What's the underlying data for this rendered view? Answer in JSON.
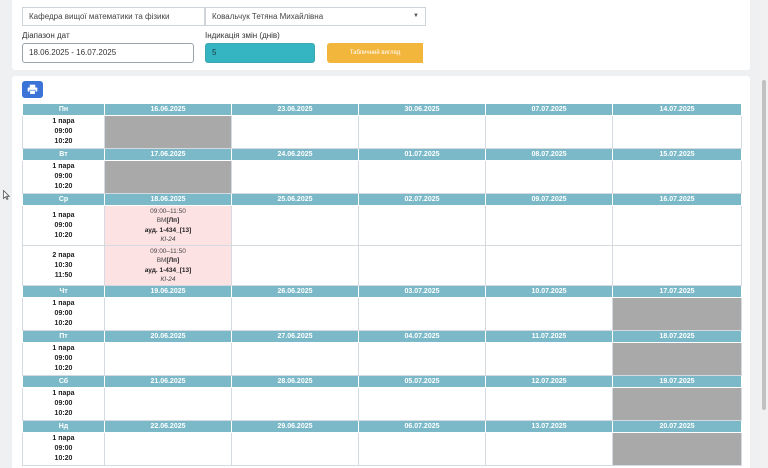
{
  "filters": {
    "department": "Кафедра вищої математики та фізики",
    "teacher": "Ковальчук Тетяна Михайлівна",
    "date_range_label": "Діапазон дат",
    "date_range_value": "18.06.2025 - 16.07.2025",
    "change_days_label": "Індикація змін (днів)",
    "change_days_value": "5",
    "view_button": "Табличний вигляд"
  },
  "schedule": {
    "days": [
      {
        "name": "Пн",
        "dates": [
          "16.06.2025",
          "23.06.2025",
          "30.06.2025",
          "07.07.2025",
          "14.07.2025"
        ],
        "rows": [
          {
            "pair": "1 пара",
            "start": "09:00",
            "end": "10:20",
            "cells": [
              "gray",
              "",
              "",
              "",
              ""
            ]
          }
        ]
      },
      {
        "name": "Вт",
        "dates": [
          "17.06.2025",
          "24.06.2025",
          "01.07.2025",
          "08.07.2025",
          "15.07.2025"
        ],
        "rows": [
          {
            "pair": "1 пара",
            "start": "09:00",
            "end": "10:20",
            "cells": [
              "gray",
              "",
              "",
              "",
              ""
            ]
          }
        ]
      },
      {
        "name": "Ср",
        "dates": [
          "18.06.2025",
          "25.06.2025",
          "02.07.2025",
          "09.07.2025",
          "16.07.2025"
        ],
        "rows": [
          {
            "pair": "1 пара",
            "start": "09:00",
            "end": "10:20",
            "cells": [
              "lesson",
              "",
              "",
              "",
              ""
            ],
            "lesson": {
              "time": "09:00–11:50",
              "subject": "ВМ",
              "type": "[Лп]",
              "room": "ауд. 1-434_[13]",
              "group": "КІ-24"
            }
          },
          {
            "pair": "2 пара",
            "start": "10:30",
            "end": "11:50",
            "cells": [
              "lesson",
              "",
              "",
              "",
              ""
            ],
            "lesson": {
              "time": "09:00–11:50",
              "subject": "ВМ",
              "type": "[Лп]",
              "room": "ауд. 1-434_[13]",
              "group": "КІ-24"
            }
          }
        ]
      },
      {
        "name": "Чт",
        "dates": [
          "19.06.2025",
          "26.06.2025",
          "03.07.2025",
          "10.07.2025",
          "17.07.2025"
        ],
        "rows": [
          {
            "pair": "1 пара",
            "start": "09:00",
            "end": "10:20",
            "cells": [
              "",
              "",
              "",
              "",
              "gray"
            ]
          }
        ]
      },
      {
        "name": "Пт",
        "dates": [
          "20.06.2025",
          "27.06.2025",
          "04.07.2025",
          "11.07.2025",
          "18.07.2025"
        ],
        "rows": [
          {
            "pair": "1 пара",
            "start": "09:00",
            "end": "10:20",
            "cells": [
              "",
              "",
              "",
              "",
              "gray"
            ]
          }
        ]
      },
      {
        "name": "Сб",
        "dates": [
          "21.06.2025",
          "28.06.2025",
          "05.07.2025",
          "12.07.2025",
          "19.07.2025"
        ],
        "rows": [
          {
            "pair": "1 пара",
            "start": "09:00",
            "end": "10:20",
            "cells": [
              "",
              "",
              "",
              "",
              "gray"
            ]
          }
        ]
      },
      {
        "name": "Нд",
        "dates": [
          "22.06.2025",
          "29.06.2025",
          "06.07.2025",
          "13.07.2025",
          "20.07.2025"
        ],
        "rows": [
          {
            "pair": "1 пара",
            "start": "09:00",
            "end": "10:20",
            "cells": [
              "",
              "",
              "",
              "",
              "gray"
            ]
          }
        ]
      }
    ]
  },
  "colors": {
    "header": "#7bb9c8",
    "unavailable": "#a9a9a9",
    "lesson": "#fde2e4",
    "days_input": "#35b5c2",
    "view_button": "#f3b63d",
    "print_button": "#3b74d6"
  }
}
